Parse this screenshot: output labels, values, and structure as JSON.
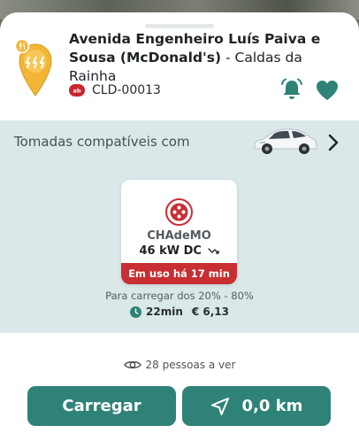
{
  "station": {
    "address_main": "Avenida Engenheiro Luís Paiva e Sousa (McDonald's)",
    "address_city": " - Caldas da Rainha",
    "operator_logo_text": "ab",
    "id": "CLD-00013",
    "pin_icon": "lightning-pin-icon",
    "amenity_icon": "fork-knife-icon"
  },
  "compatibility": {
    "label": "Tomadas compatíveis com",
    "vehicle_icon": "ev-car-icon"
  },
  "connector": {
    "type": "CHAdeMO",
    "power": "46 kW DC",
    "status": "Em uso há 17 min",
    "status_color": "#c72f33"
  },
  "estimate": {
    "range_text": "Para carregar dos 20% - 80%",
    "time": "22min",
    "currency": "€",
    "cost": "€ 6,13"
  },
  "viewers": {
    "text": "28 pessoas a ver"
  },
  "actions": {
    "charge_label": "Carregar",
    "distance_label": "0,0 km"
  },
  "colors": {
    "accent": "#2f8278",
    "pin": "#f2b535",
    "panel_bg": "#dae8ea",
    "danger": "#c72f33"
  }
}
